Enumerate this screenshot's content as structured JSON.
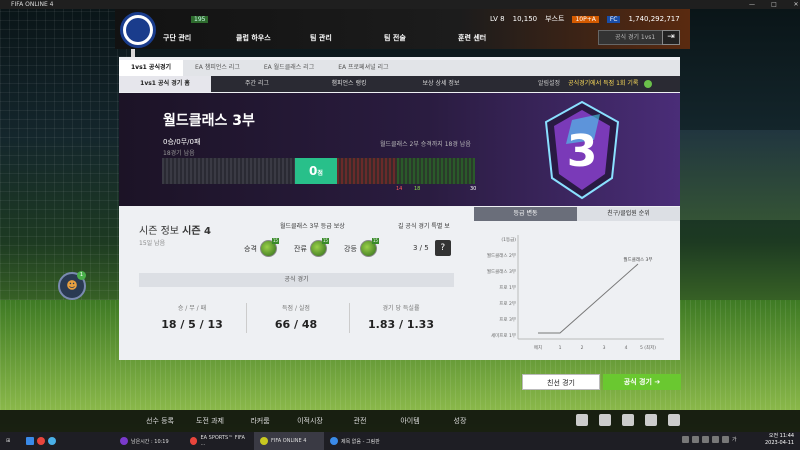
{
  "window": {
    "title": "FIFA ONLINE 4",
    "controls": [
      "—",
      "□",
      "✕"
    ]
  },
  "club": {
    "level_badge": "195"
  },
  "header": {
    "level": "LV 8",
    "points": "10,150",
    "boost_label": "부스트",
    "boost_value": "10P+A",
    "bp": "1,740,292,717",
    "nav": [
      "구단 관리",
      "클럽 하우스",
      "팀 관리",
      "팀 전술",
      "훈련 센터"
    ],
    "search_placeholder": "공식 경기 1vs1"
  },
  "tabs": {
    "primary": [
      "1vs1 공식경기",
      "EA 챔피언스 리그",
      "EA 월드클래스 리그",
      "EA 프로페셔널 리그"
    ],
    "secondary": [
      "1vs1 공식 경기 홈",
      "주간 리그",
      "챔피언스 랭킹",
      "보상 상세 정보"
    ],
    "notify_label": "알림설정",
    "record_text": "공식경기에서 득점 1회 기록"
  },
  "division": {
    "title": "월드클래스 3부",
    "record": "0승/0무/0패",
    "remaining": "18경기 남음",
    "target": "월드클래스 2부 승격까지 18경 남음",
    "points": "0",
    "points_unit": "점",
    "ticks": [
      "14",
      "18",
      "30"
    ],
    "badge_number": "3"
  },
  "season": {
    "label": "시즌 정보",
    "number": "시즌 4",
    "days": "15일 남음",
    "promo_title": "월드클래스 3부 등급 보상",
    "promos": [
      {
        "label": "승격",
        "tag": "15"
      },
      {
        "label": "잔류",
        "tag": "15"
      },
      {
        "label": "강등",
        "tag": "15"
      }
    ],
    "bonus_title": "길 공식 경기 특별 보",
    "bonus_value": "3 / 5",
    "bonus_tag": "15",
    "official_label": "공식 경기"
  },
  "stats": [
    {
      "label": "승 / 무 / 패",
      "value": "18 / 5 / 13"
    },
    {
      "label": "득점 / 실점",
      "value": "66 / 48"
    },
    {
      "label": "경기 당 득실률",
      "value": "1.83 / 1.33"
    }
  ],
  "graph": {
    "tabs": [
      "등급 변동",
      "친구/클럽원 순위"
    ],
    "y_labels": [
      "(1등급)",
      "월드클래스 2부",
      "월드클래스 3부",
      "프로 1부",
      "프로 2부",
      "프로 3부",
      "세미프로 1부"
    ],
    "x_labels": [
      "메치",
      "1",
      "2",
      "3",
      "4",
      "5 (최저)"
    ],
    "annotation": "월드클래스 3부",
    "line_color": "#777777"
  },
  "actions": {
    "friendly": "친선 경기",
    "official": "공식 경기"
  },
  "bottom_nav": [
    "선수 등록",
    "도전 과제",
    "라커룸",
    "이적시장",
    "관전",
    "아이템",
    "성장"
  ],
  "chat_count": "1",
  "taskbar": {
    "items": [
      {
        "label": "남은시간 : 10:19",
        "color": "#7a3acc"
      },
      {
        "label": "EA SPORTS™ FIFA ...",
        "color": "#e8453c"
      },
      {
        "label": "FIFA ONLINE 4",
        "color": "#c8c820"
      },
      {
        "label": "제목 없음 - 그림판",
        "color": "#3a8ae8"
      }
    ],
    "lang": "가",
    "time": "오전 11:44",
    "date": "2023-04-11"
  }
}
